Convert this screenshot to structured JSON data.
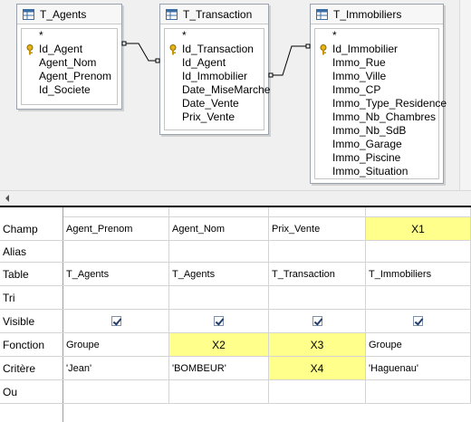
{
  "tables": [
    {
      "name": "T_Agents",
      "fields": [
        "*",
        "Id_Agent",
        "Agent_Nom",
        "Agent_Prenom",
        "Id_Societe"
      ],
      "key_field": "Id_Agent"
    },
    {
      "name": "T_Transaction",
      "fields": [
        "*",
        "Id_Transaction",
        "Id_Agent",
        "Id_Immobilier",
        "Date_MiseMarche",
        "Date_Vente",
        "Prix_Vente"
      ],
      "key_field": "Id_Transaction"
    },
    {
      "name": "T_Immobiliers",
      "fields": [
        "*",
        "Id_Immobilier",
        "Immo_Rue",
        "Immo_Ville",
        "Immo_CP",
        "Immo_Type_Residence",
        "Immo_Nb_Chambres",
        "Immo_Nb_SdB",
        "Immo_Garage",
        "Immo_Piscine",
        "Immo_Situation"
      ],
      "key_field": "Id_Immobilier"
    }
  ],
  "grid": {
    "row_labels": [
      "Champ",
      "Alias",
      "Table",
      "Tri",
      "Visible",
      "Fonction",
      "Critère",
      "Ou"
    ],
    "columns": [
      {
        "champ": "Agent_Prenom",
        "alias": "",
        "table": "T_Agents",
        "tri": "",
        "visible": true,
        "fonction": "Groupe",
        "critere": "'Jean'",
        "ou": ""
      },
      {
        "champ": "Agent_Nom",
        "alias": "",
        "table": "T_Agents",
        "tri": "",
        "visible": true,
        "fonction": "X2",
        "critere": "'BOMBEUR'",
        "ou": ""
      },
      {
        "champ": "Prix_Vente",
        "alias": "",
        "table": "T_Transaction",
        "tri": "",
        "visible": true,
        "fonction": "X3",
        "critere": "X4",
        "ou": ""
      },
      {
        "champ": "X1",
        "alias": "",
        "table": "T_Immobiliers",
        "tri": "",
        "visible": true,
        "fonction": "Groupe",
        "critere": "'Haguenau'",
        "ou": ""
      }
    ],
    "highlight_color": "#ffff8c"
  },
  "icons": {
    "table": "table-icon",
    "key": "key-icon",
    "scroll_left": "scroll-left-arrow-icon"
  }
}
